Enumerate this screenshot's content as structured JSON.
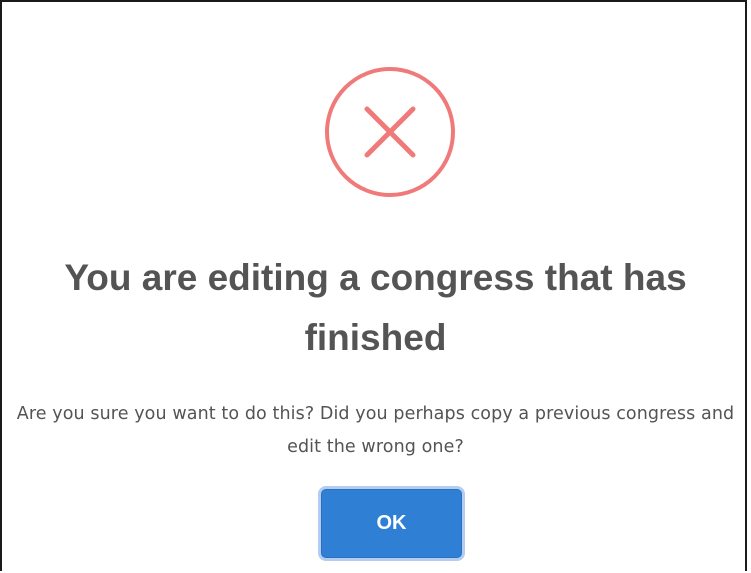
{
  "dialog": {
    "icon": "error-x-icon",
    "title": "You are editing a congress that has finished",
    "message": "Are you sure you want to do this? Did you perhaps copy a previous congress and edit the wrong one?",
    "ok_label": "OK"
  },
  "colors": {
    "icon": "#f07a7a",
    "text": "#545454",
    "button": "#2f7fd5",
    "button_focus_ring": "#b3ccf0"
  }
}
